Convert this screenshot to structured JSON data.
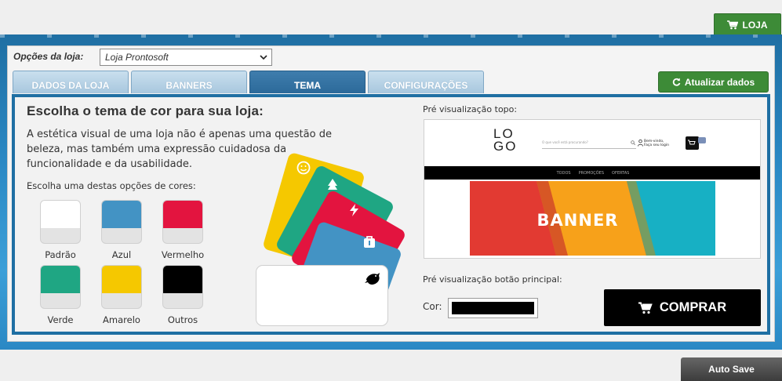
{
  "header": {
    "loja_label": "LOJA",
    "loja_icon": "cart-icon"
  },
  "options": {
    "label": "Opções da loja:",
    "selected": "Loja Prontosoft"
  },
  "tabs": [
    {
      "label": "DADOS DA LOJA",
      "active": false
    },
    {
      "label": "BANNERS",
      "active": false
    },
    {
      "label": "TEMA",
      "active": true
    },
    {
      "label": "CONFIGURAÇÕES",
      "active": false
    }
  ],
  "update_button": {
    "label": "Atualizar dados",
    "icon": "refresh-icon"
  },
  "theme": {
    "title": "Escolha o tema de cor para sua loja:",
    "description": "A estética visual de uma loja não é apenas uma questão de beleza, mas também uma expressão cuidadosa da funcionalidade e da usabilidade.",
    "choose_label": "Escolha uma destas opções de cores:",
    "swatches": [
      {
        "label": "Padrão",
        "color": "#ffffff"
      },
      {
        "label": "Azul",
        "color": "#4393c4"
      },
      {
        "label": "Vermelho",
        "color": "#e3143f"
      },
      {
        "label": "Verde",
        "color": "#1fa683"
      },
      {
        "label": "Amarelo",
        "color": "#f5c800"
      },
      {
        "label": "Outros",
        "color": "#000000"
      }
    ]
  },
  "preview": {
    "top_label": "Pré visualização topo:",
    "logo_line1": "LO",
    "logo_line2": "GO",
    "search_placeholder": "O que você está procurando?",
    "user_line1": "Bem-vindo,",
    "user_line2": "Faça seu login",
    "nav": [
      "TODOS",
      "PROMOÇÕES",
      "OFERTAS"
    ],
    "banner_text": "BANNER",
    "button_label": "Pré visualização botão principal:",
    "cor_label": "Cor:",
    "cor_value": "#000000",
    "buy_label": "COMPRAR"
  },
  "footer": {
    "autosave_label": "Auto Save"
  }
}
